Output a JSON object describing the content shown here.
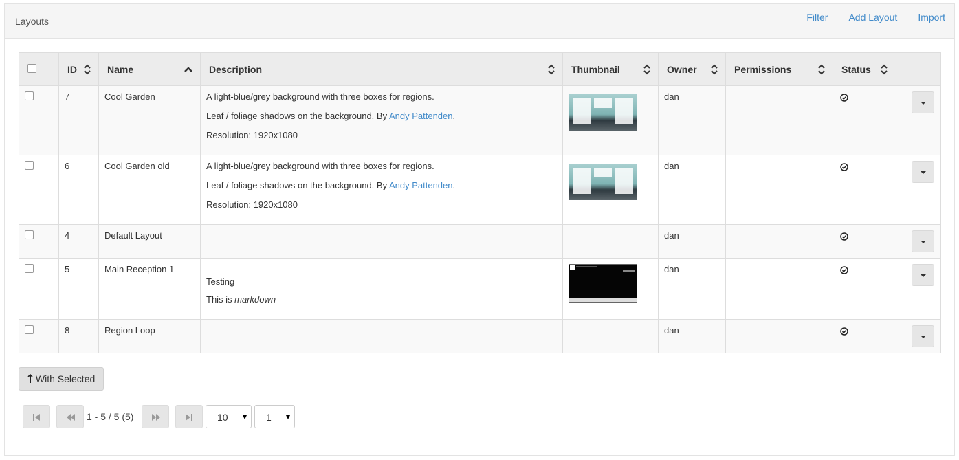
{
  "header": {
    "title": "Layouts",
    "links": {
      "filter": "Filter",
      "add_layout": "Add Layout",
      "import": "Import"
    }
  },
  "table": {
    "columns": {
      "id": "ID",
      "name": "Name",
      "description": "Description",
      "thumbnail": "Thumbnail",
      "owner": "Owner",
      "permissions": "Permissions",
      "status": "Status"
    },
    "rows": [
      {
        "id": "7",
        "name": "Cool Garden",
        "desc_line1": "A light-blue/grey background with three boxes for regions.",
        "desc_line2_pre": "Leaf / foliage shadows on the background. By ",
        "desc_link": "Andy Pattenden",
        "desc_line2_post": ".",
        "desc_line3": "Resolution: 1920x1080",
        "thumbnail": "garden",
        "owner": "dan",
        "permissions": "",
        "status_icon": "check-circle-icon"
      },
      {
        "id": "6",
        "name": "Cool Garden old",
        "desc_line1": "A light-blue/grey background with three boxes for regions.",
        "desc_line2_pre": "Leaf / foliage shadows on the background. By ",
        "desc_link": "Andy Pattenden",
        "desc_line2_post": ".",
        "desc_line3": "Resolution: 1920x1080",
        "thumbnail": "garden",
        "owner": "dan",
        "permissions": "",
        "status_icon": "check-circle-icon"
      },
      {
        "id": "4",
        "name": "Default Layout",
        "owner": "dan",
        "permissions": "",
        "status_icon": "check-circle-icon"
      },
      {
        "id": "5",
        "name": "Main Reception 1",
        "desc_text": "Testing",
        "desc_text2_pre": "This is ",
        "desc_text2_em": "markdown",
        "thumbnail": "dark",
        "owner": "dan",
        "permissions": "",
        "status_icon": "check-circle-icon"
      },
      {
        "id": "8",
        "name": "Region Loop",
        "owner": "dan",
        "permissions": "",
        "status_icon": "check-circle-icon"
      }
    ]
  },
  "actions": {
    "with_selected": "With Selected"
  },
  "pager": {
    "info": "1 - 5 / 5 (5)",
    "page_size": "10",
    "page": "1"
  },
  "colors": {
    "link": "#428bca",
    "header_bg": "#f5f5f5",
    "button_bg": "#e6e6e6"
  }
}
